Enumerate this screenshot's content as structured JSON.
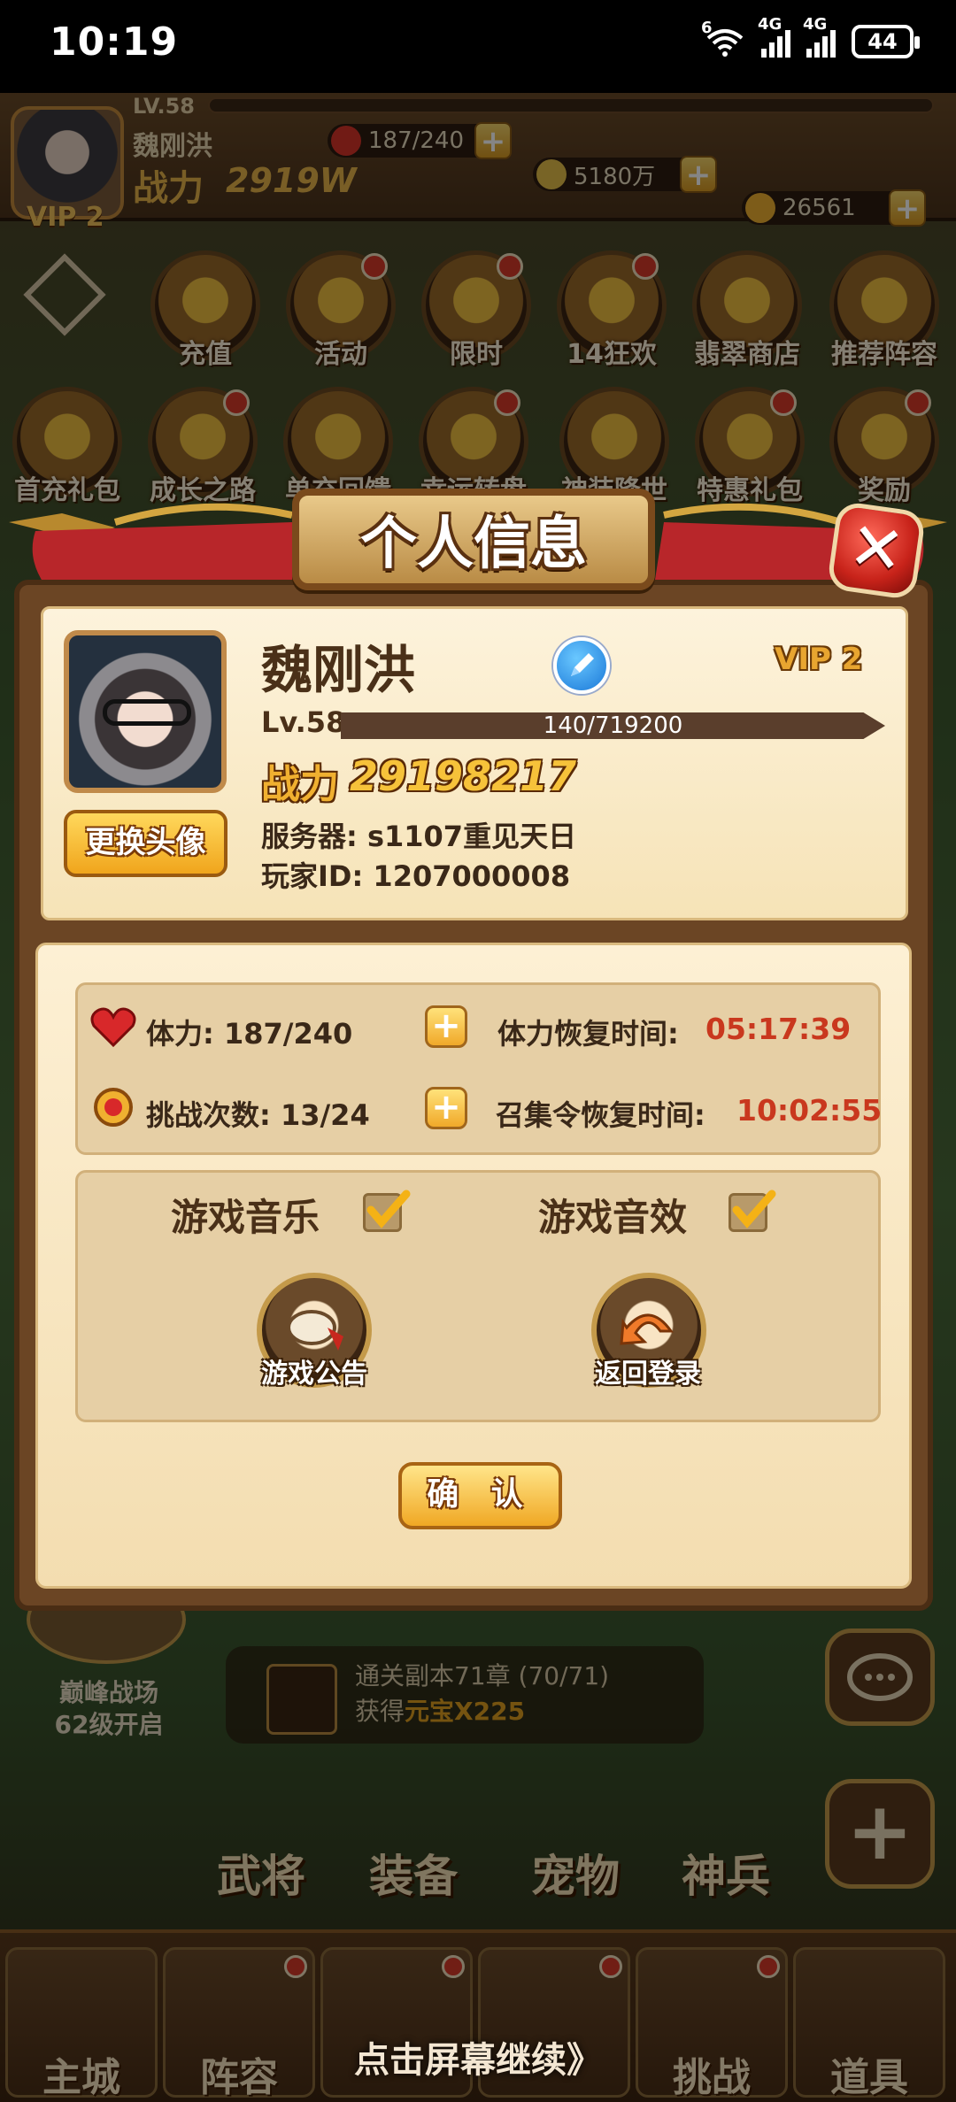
{
  "status_bar": {
    "time": "10:19",
    "wifi_label": "6",
    "net1": "4G",
    "net2": "4G",
    "battery": "44"
  },
  "top_bar": {
    "level": "LV.58",
    "player_name": "魏刚洪",
    "power_label": "战力",
    "power_value": "2919W",
    "vip": "VIP 2",
    "stamina": "187/240",
    "silver": "5180万",
    "gold": "26561"
  },
  "activity_icons": [
    {
      "label": "充值",
      "dot": false
    },
    {
      "label": "活动",
      "dot": true
    },
    {
      "label": "限时",
      "dot": true
    },
    {
      "label": "14狂欢",
      "dot": true
    },
    {
      "label": "翡翠商店",
      "dot": false
    },
    {
      "label": "推荐阵容",
      "dot": false
    },
    {
      "label": "首充礼包",
      "dot": false
    },
    {
      "label": "成长之路",
      "dot": true
    },
    {
      "label": "单充回馈",
      "dot": false
    },
    {
      "label": "幸运转盘",
      "dot": true
    },
    {
      "label": "神装降世",
      "dot": false
    },
    {
      "label": "特惠礼包",
      "dot": true
    },
    {
      "label": "奖励",
      "dot": true
    }
  ],
  "modal": {
    "title": "个人信息",
    "player_name": "魏刚洪",
    "vip": "VIP 2",
    "level": "Lv.58",
    "exp": "140/719200",
    "exp_fraction": 0.0002,
    "power_label": "战力",
    "power_value": "29198217",
    "change_avatar_button": "更换头像",
    "server_label": "服务器:",
    "server_value": "s1107重见天日",
    "player_id_label": "玩家ID:",
    "player_id_value": "1207000008",
    "stamina_label": "体力:",
    "stamina_value": "187/240",
    "stamina_recover_label": "体力恢复时间:",
    "stamina_recover_time": "05:17:39",
    "challenge_label": "挑战次数:",
    "challenge_value": "13/24",
    "summon_recover_label": "召集令恢复时间:",
    "summon_recover_time": "10:02:55",
    "music_label": "游戏音乐",
    "music_checked": true,
    "sfx_label": "游戏音效",
    "sfx_checked": true,
    "announcement_button": "游戏公告",
    "back_login_button": "返回登录",
    "confirm_button": "确 认"
  },
  "scene": {
    "peak_battle_label": "巅峰战场",
    "peak_battle_unlock": "62级开启",
    "chapter_tip": "通关副本71章 (70/71)",
    "reward_prefix": "获得",
    "reward_value": "元宝X225",
    "heroes": [
      "武将",
      "装备",
      "宠物",
      "神兵"
    ],
    "continue_hint": "点击屏幕继续》"
  },
  "bottom_nav": [
    {
      "label": "主城",
      "dot": false
    },
    {
      "label": "阵容",
      "dot": true
    },
    {
      "label": "",
      "dot": true
    },
    {
      "label": "",
      "dot": true
    },
    {
      "label": "挑战",
      "dot": true
    },
    {
      "label": "道具",
      "dot": false
    }
  ],
  "colors": {
    "accent_gold": "#f0b030",
    "timer_red": "#c9381e",
    "panel_cream": "#fdf3dc",
    "frame_brown": "#6b4524"
  }
}
